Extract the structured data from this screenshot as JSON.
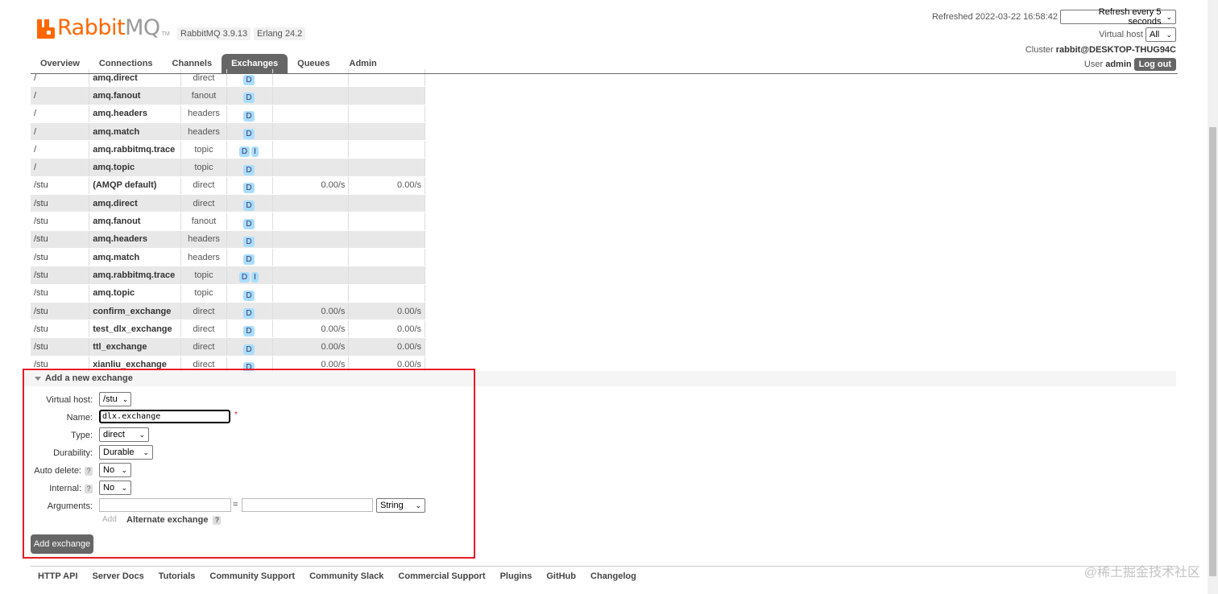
{
  "header": {
    "logo_brand": "Rabbit",
    "logo_mq": "MQ",
    "logo_tm": "TM",
    "rabbitmq_version": "RabbitMQ 3.9.13",
    "erlang_version": "Erlang 24.2",
    "refreshed_label": "Refreshed 2022-03-22 16:58:42",
    "refresh_select": "Refresh every 5 seconds",
    "virtual_host_label": "Virtual host",
    "virtual_host_select": "All",
    "cluster_label": "Cluster",
    "cluster_name": "rabbit@DESKTOP-THUG94C",
    "user_label": "User",
    "user_name": "admin",
    "logout_label": "Log out"
  },
  "nav": {
    "tabs": [
      {
        "label": "Overview"
      },
      {
        "label": "Connections"
      },
      {
        "label": "Channels"
      },
      {
        "label": "Exchanges",
        "active": true
      },
      {
        "label": "Queues"
      },
      {
        "label": "Admin"
      }
    ]
  },
  "exchanges": [
    {
      "vhost": "/",
      "name": "amq.direct",
      "type": "direct",
      "features": [
        "D"
      ],
      "rate_in": "",
      "rate_out": ""
    },
    {
      "vhost": "/",
      "name": "amq.fanout",
      "type": "fanout",
      "features": [
        "D"
      ],
      "rate_in": "",
      "rate_out": ""
    },
    {
      "vhost": "/",
      "name": "amq.headers",
      "type": "headers",
      "features": [
        "D"
      ],
      "rate_in": "",
      "rate_out": ""
    },
    {
      "vhost": "/",
      "name": "amq.match",
      "type": "headers",
      "features": [
        "D"
      ],
      "rate_in": "",
      "rate_out": ""
    },
    {
      "vhost": "/",
      "name": "amq.rabbitmq.trace",
      "type": "topic",
      "features": [
        "D",
        "I"
      ],
      "rate_in": "",
      "rate_out": ""
    },
    {
      "vhost": "/",
      "name": "amq.topic",
      "type": "topic",
      "features": [
        "D"
      ],
      "rate_in": "",
      "rate_out": ""
    },
    {
      "vhost": "/stu",
      "name": "(AMQP default)",
      "type": "direct",
      "features": [
        "D"
      ],
      "rate_in": "0.00/s",
      "rate_out": "0.00/s"
    },
    {
      "vhost": "/stu",
      "name": "amq.direct",
      "type": "direct",
      "features": [
        "D"
      ],
      "rate_in": "",
      "rate_out": ""
    },
    {
      "vhost": "/stu",
      "name": "amq.fanout",
      "type": "fanout",
      "features": [
        "D"
      ],
      "rate_in": "",
      "rate_out": ""
    },
    {
      "vhost": "/stu",
      "name": "amq.headers",
      "type": "headers",
      "features": [
        "D"
      ],
      "rate_in": "",
      "rate_out": ""
    },
    {
      "vhost": "/stu",
      "name": "amq.match",
      "type": "headers",
      "features": [
        "D"
      ],
      "rate_in": "",
      "rate_out": ""
    },
    {
      "vhost": "/stu",
      "name": "amq.rabbitmq.trace",
      "type": "topic",
      "features": [
        "D",
        "I"
      ],
      "rate_in": "",
      "rate_out": ""
    },
    {
      "vhost": "/stu",
      "name": "amq.topic",
      "type": "topic",
      "features": [
        "D"
      ],
      "rate_in": "",
      "rate_out": ""
    },
    {
      "vhost": "/stu",
      "name": "confirm_exchange",
      "type": "direct",
      "features": [
        "D"
      ],
      "rate_in": "0.00/s",
      "rate_out": "0.00/s"
    },
    {
      "vhost": "/stu",
      "name": "test_dlx_exchange",
      "type": "direct",
      "features": [
        "D"
      ],
      "rate_in": "0.00/s",
      "rate_out": "0.00/s"
    },
    {
      "vhost": "/stu",
      "name": "ttl_exchange",
      "type": "direct",
      "features": [
        "D"
      ],
      "rate_in": "0.00/s",
      "rate_out": "0.00/s"
    },
    {
      "vhost": "/stu",
      "name": "xianliu_exchange",
      "type": "direct",
      "features": [
        "D"
      ],
      "rate_in": "0.00/s",
      "rate_out": "0.00/s"
    }
  ],
  "add_exchange": {
    "title": "Add a new exchange",
    "virtual_host_label": "Virtual host:",
    "virtual_host_value": "/stu",
    "name_label": "Name:",
    "name_value": "dlx.exchange",
    "required_mark": "*",
    "type_label": "Type:",
    "type_value": "direct",
    "durability_label": "Durability:",
    "durability_value": "Durable",
    "auto_delete_label": "Auto delete:",
    "auto_delete_value": "No",
    "internal_label": "Internal:",
    "internal_value": "No",
    "arguments_label": "Arguments:",
    "arguments_eq": "=",
    "arguments_type": "String",
    "add_link": "Add",
    "alternate_exchange": "Alternate exchange",
    "help_mark": "?",
    "submit_label": "Add exchange"
  },
  "footer": {
    "links": [
      "HTTP API",
      "Server Docs",
      "Tutorials",
      "Community Support",
      "Community Slack",
      "Commercial Support",
      "Plugins",
      "GitHub",
      "Changelog"
    ]
  },
  "watermark": "@稀土掘金技术社区",
  "colors": {
    "accent": "#ff6600",
    "highlight_border": "#e81b26",
    "tab_active": "#666666",
    "feature_badge": "#aaddff"
  }
}
